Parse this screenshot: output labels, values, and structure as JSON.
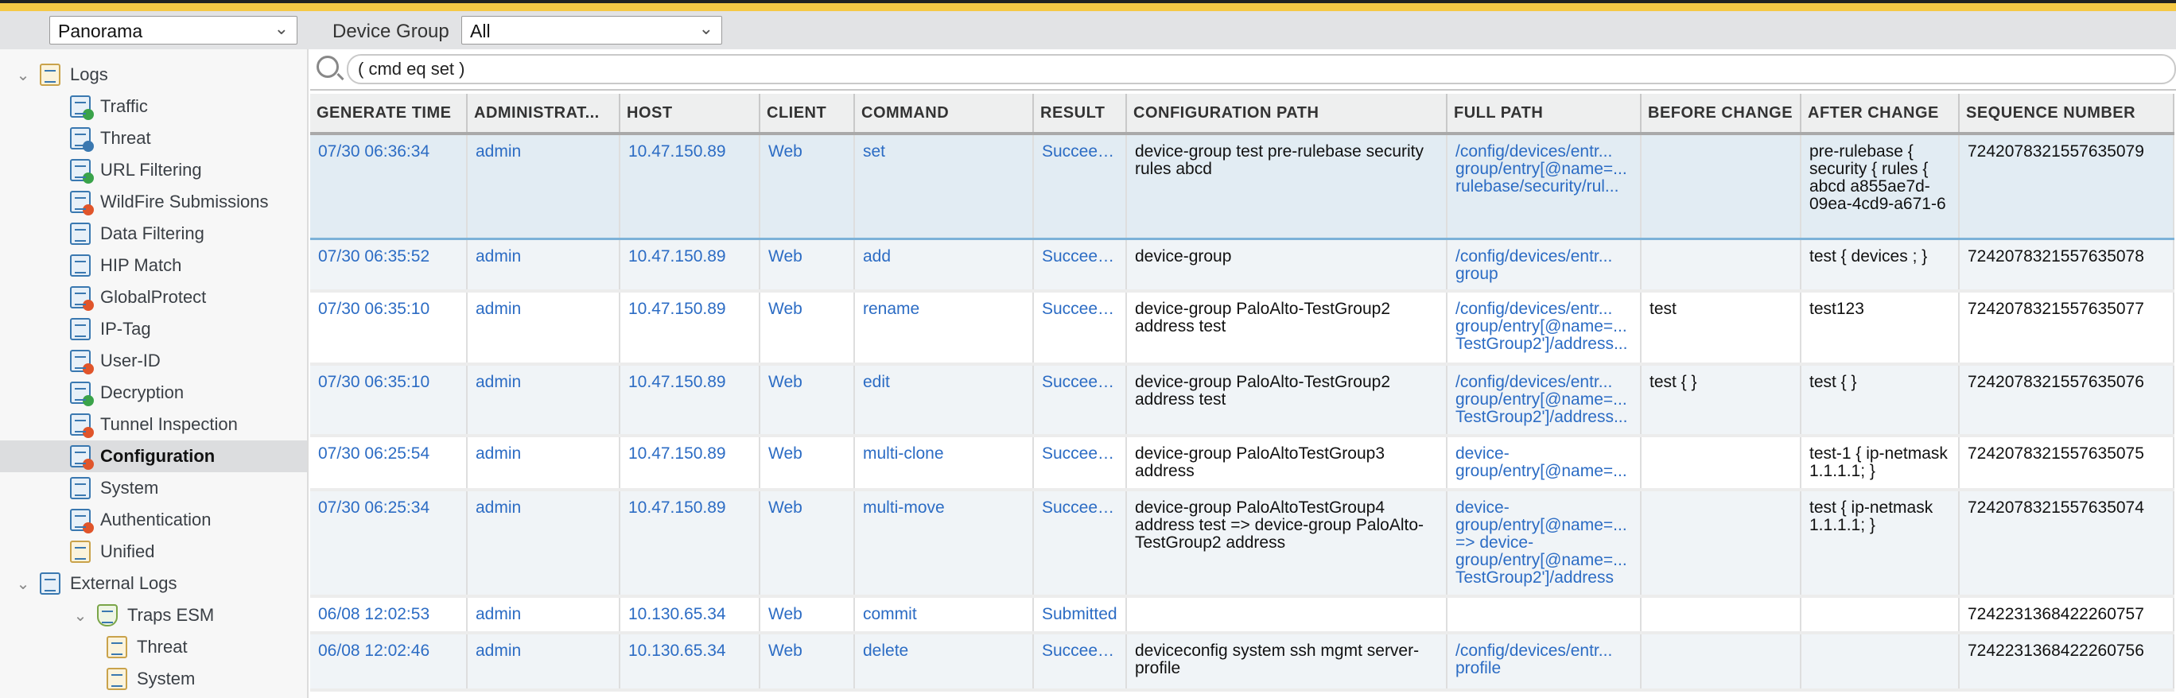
{
  "toolbar": {
    "context": "Panorama",
    "device_group_label": "Device Group",
    "device_group": "All"
  },
  "sidebar": {
    "items": [
      {
        "label": "Logs",
        "level": 0,
        "expanded": true,
        "icon": "logs-folder-icon"
      },
      {
        "label": "Traffic",
        "level": 1,
        "icon": "traffic-icon"
      },
      {
        "label": "Threat",
        "level": 1,
        "icon": "threat-icon"
      },
      {
        "label": "URL Filtering",
        "level": 1,
        "icon": "url-filtering-icon"
      },
      {
        "label": "WildFire Submissions",
        "level": 1,
        "icon": "wildfire-icon"
      },
      {
        "label": "Data Filtering",
        "level": 1,
        "icon": "data-filtering-icon"
      },
      {
        "label": "HIP Match",
        "level": 1,
        "icon": "hip-match-icon"
      },
      {
        "label": "GlobalProtect",
        "level": 1,
        "icon": "globalprotect-icon"
      },
      {
        "label": "IP-Tag",
        "level": 1,
        "icon": "ip-tag-icon"
      },
      {
        "label": "User-ID",
        "level": 1,
        "icon": "user-id-icon"
      },
      {
        "label": "Decryption",
        "level": 1,
        "icon": "decryption-icon"
      },
      {
        "label": "Tunnel Inspection",
        "level": 1,
        "icon": "tunnel-inspection-icon"
      },
      {
        "label": "Configuration",
        "level": 1,
        "icon": "configuration-icon",
        "selected": true
      },
      {
        "label": "System",
        "level": 1,
        "icon": "system-icon"
      },
      {
        "label": "Authentication",
        "level": 1,
        "icon": "authentication-icon"
      },
      {
        "label": "Unified",
        "level": 1,
        "icon": "unified-folder-icon"
      },
      {
        "label": "External Logs",
        "level": 0,
        "expanded": true,
        "icon": "external-logs-icon"
      },
      {
        "label": "Traps ESM",
        "level": 1,
        "expanded": true,
        "icon": "traps-shield-icon"
      },
      {
        "label": "Threat",
        "level": 2,
        "icon": "folder-icon"
      },
      {
        "label": "System",
        "level": 2,
        "icon": "folder-icon"
      }
    ]
  },
  "search": {
    "query": "( cmd eq set )"
  },
  "table": {
    "columns": [
      "GENERATE TIME",
      "ADMINISTRAT...",
      "HOST",
      "CLIENT",
      "COMMAND",
      "RESULT",
      "CONFIGURATION PATH",
      "FULL PATH",
      "BEFORE CHANGE",
      "AFTER CHANGE",
      "SEQUENCE NUMBER"
    ],
    "rows": [
      {
        "time": "07/30 06:36:34",
        "admin": "admin",
        "host": "10.47.150.89",
        "client": "Web",
        "command": "set",
        "result": "Succeed...",
        "config_path": "device-group test pre-rulebase security rules abcd",
        "full_path": [
          "/config/devices/entr...",
          "group/entry[@name=...",
          "rulebase/security/rul..."
        ],
        "before": "",
        "after": "pre-rulebase { security { rules { abcd a855ae7d-09ea-4cd9-a671-6",
        "seq": "7242078321557635079"
      },
      {
        "time": "07/30 06:35:52",
        "admin": "admin",
        "host": "10.47.150.89",
        "client": "Web",
        "command": "add",
        "result": "Succeed...",
        "config_path": "device-group",
        "full_path": [
          "/config/devices/entr...",
          "group"
        ],
        "before": "",
        "after": "test { devices ; }",
        "seq": "7242078321557635078"
      },
      {
        "time": "07/30 06:35:10",
        "admin": "admin",
        "host": "10.47.150.89",
        "client": "Web",
        "command": "rename",
        "result": "Succeed...",
        "config_path": "device-group PaloAlto-TestGroup2 address test",
        "full_path": [
          "/config/devices/entr...",
          "group/entry[@name=...",
          "TestGroup2']/address..."
        ],
        "before": "test",
        "after": "test123",
        "seq": "7242078321557635077"
      },
      {
        "time": "07/30 06:35:10",
        "admin": "admin",
        "host": "10.47.150.89",
        "client": "Web",
        "command": "edit",
        "result": "Succeed...",
        "config_path": "device-group PaloAlto-TestGroup2 address test",
        "full_path": [
          "/config/devices/entr...",
          "group/entry[@name=...",
          "TestGroup2']/address..."
        ],
        "before": "test { }",
        "after": "test { }",
        "seq": "7242078321557635076"
      },
      {
        "time": "07/30 06:25:54",
        "admin": "admin",
        "host": "10.47.150.89",
        "client": "Web",
        "command": "multi-clone",
        "result": "Succeed...",
        "config_path": "device-group PaloAltoTestGroup3 address",
        "full_path": [
          "device-",
          "group/entry[@name=..."
        ],
        "before": "",
        "after": "test-1 { ip-netmask 1.1.1.1; }",
        "seq": "7242078321557635075"
      },
      {
        "time": "07/30 06:25:34",
        "admin": "admin",
        "host": "10.47.150.89",
        "client": "Web",
        "command": "multi-move",
        "result": "Succeed...",
        "config_path": "device-group PaloAltoTestGroup4 address test => device-group PaloAlto-TestGroup2 address",
        "full_path": [
          "device-",
          "group/entry[@name=...",
          "=> device-",
          "group/entry[@name=...",
          "TestGroup2']/address"
        ],
        "before": "",
        "after": "test { ip-netmask 1.1.1.1; }",
        "seq": "7242078321557635074"
      },
      {
        "time": "06/08 12:02:53",
        "admin": "admin",
        "host": "10.130.65.34",
        "client": "Web",
        "command": "commit",
        "result": "Submitted",
        "config_path": "",
        "full_path": [],
        "before": "",
        "after": "",
        "seq": "7242231368422260757"
      },
      {
        "time": "06/08 12:02:46",
        "admin": "admin",
        "host": "10.130.65.34",
        "client": "Web",
        "command": "delete",
        "result": "Succeed...",
        "config_path": "deviceconfig system ssh mgmt server-profile",
        "full_path": [
          "/config/devices/entr...",
          "profile"
        ],
        "before": "",
        "after": "",
        "seq": "7242231368422260756"
      }
    ]
  }
}
